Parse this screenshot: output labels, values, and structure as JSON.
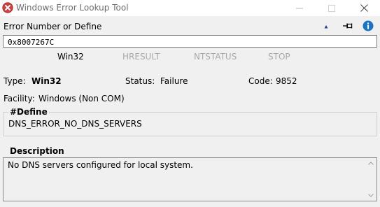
{
  "window": {
    "title": "Windows Error Lookup Tool",
    "icon": "error-x-icon",
    "controls": {
      "minimize": "minimize-icon",
      "maximize": "maximize-icon",
      "close": "close-icon"
    }
  },
  "input_section": {
    "label": "Error Number or Define",
    "value": "0x8007267C",
    "toolbar_icons": [
      "triangle-up-icon",
      "pin-icon",
      "info-icon"
    ]
  },
  "tabs": [
    {
      "label": "Win32",
      "active": true
    },
    {
      "label": "HRESULT",
      "active": false
    },
    {
      "label": "NTSTATUS",
      "active": false
    },
    {
      "label": "STOP",
      "active": false
    }
  ],
  "result": {
    "type_label": "Type:",
    "type_value": "Win32",
    "status_label": "Status:",
    "status_value": "Failure",
    "code_label": "Code:",
    "code_value": "9852",
    "facility_label": "Facility:",
    "facility_value": "Windows (Non COM)"
  },
  "define": {
    "title": "#Define",
    "value": "DNS_ERROR_NO_DNS_SERVERS"
  },
  "description": {
    "title": "Description",
    "text": "No DNS servers configured for local system."
  },
  "colors": {
    "background": "#f0f0f0",
    "title_bar": "#ffffff",
    "error_icon": "#d23f3f",
    "info_icon": "#1a73c8",
    "inactive_tab": "#a8a8a8"
  }
}
